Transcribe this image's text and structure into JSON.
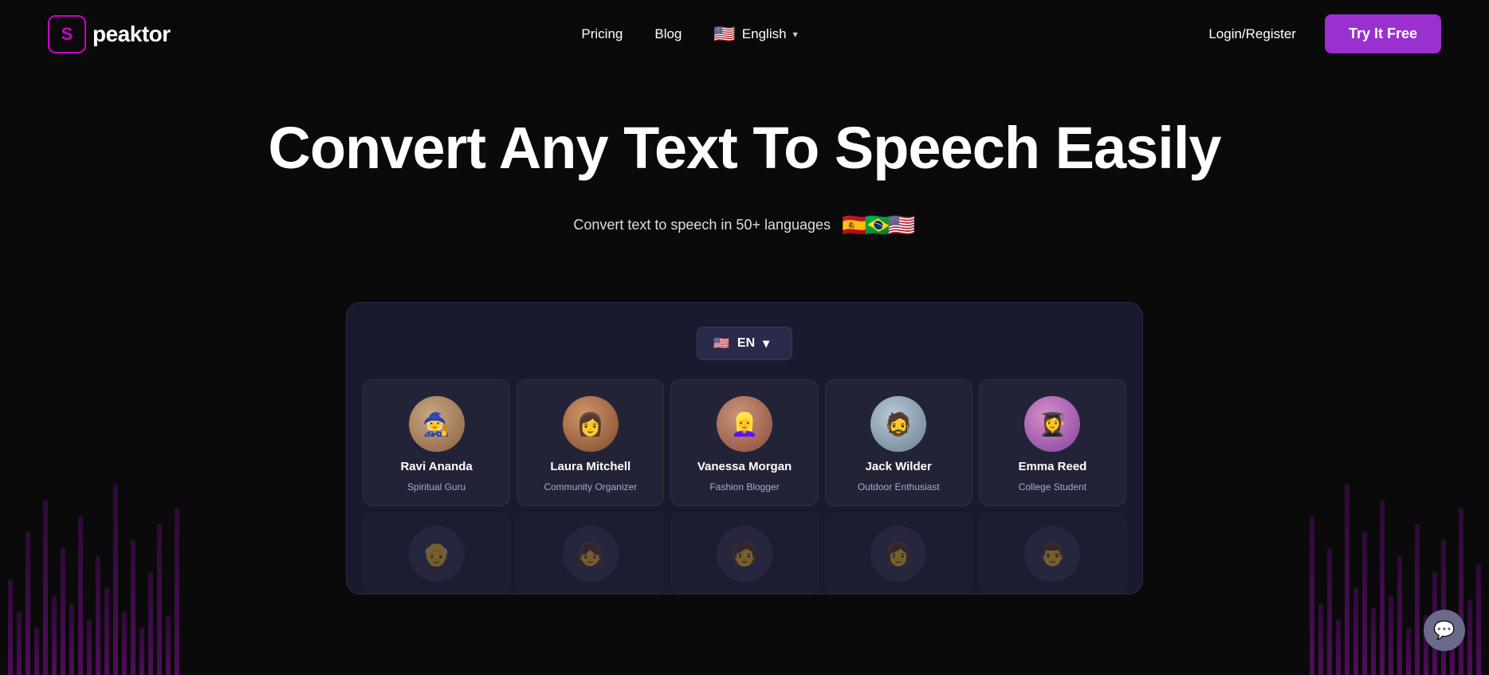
{
  "logo": {
    "icon_letter": "S",
    "text": "peaktor"
  },
  "nav": {
    "pricing_label": "Pricing",
    "blog_label": "Blog",
    "language_label": "English",
    "language_flag": "🇺🇸",
    "login_label": "Login/Register",
    "try_free_label": "Try It Free"
  },
  "hero": {
    "title": "Convert Any Text To Speech Easily",
    "subtitle": "Convert text to speech in 50+ languages",
    "flags": [
      "🇪🇸",
      "🇧🇷",
      "🇺🇸"
    ]
  },
  "demo": {
    "lang_code": "EN",
    "lang_flag": "🇺🇸",
    "voices": [
      {
        "id": "ravi",
        "name": "Ravi Ananda",
        "role": "Spiritual Guru",
        "emoji": "🧙"
      },
      {
        "id": "laura",
        "name": "Laura Mitchell",
        "role": "Community Organizer",
        "emoji": "👩"
      },
      {
        "id": "vanessa",
        "name": "Vanessa Morgan",
        "role": "Fashion Blogger",
        "emoji": "👱‍♀️"
      },
      {
        "id": "jack",
        "name": "Jack Wilder",
        "role": "Outdoor Enthusiast",
        "emoji": "🧔"
      },
      {
        "id": "emma",
        "name": "Emma Reed",
        "role": "College Student",
        "emoji": "👩‍🎓"
      }
    ],
    "row2_voices": [
      {
        "id": "r2a",
        "name": "",
        "role": "",
        "emoji": "👴"
      },
      {
        "id": "r2b",
        "name": "",
        "role": "",
        "emoji": "👧"
      },
      {
        "id": "r2c",
        "name": "",
        "role": "",
        "emoji": "🧑"
      },
      {
        "id": "r2d",
        "name": "",
        "role": "",
        "emoji": "👩"
      },
      {
        "id": "r2e",
        "name": "",
        "role": "",
        "emoji": "👨"
      }
    ]
  },
  "chat": {
    "icon": "💬"
  }
}
